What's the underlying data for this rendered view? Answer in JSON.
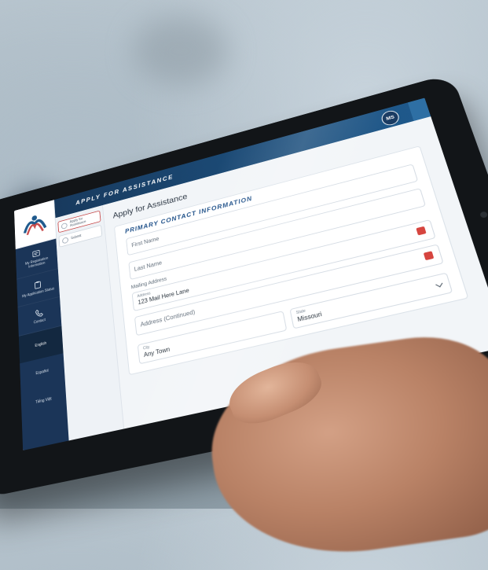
{
  "app": {
    "topbar_title": "APPLY FOR ASSISTANCE",
    "badge": "MS"
  },
  "left_nav": {
    "items": [
      {
        "label": "My Registration Information",
        "icon": "id-card-icon"
      },
      {
        "label": "My Application Status",
        "icon": "clipboard-icon"
      },
      {
        "label": "Contact",
        "icon": "phone-icon"
      }
    ],
    "languages": [
      "English",
      "Español",
      "Tiếng Việt"
    ]
  },
  "steps": [
    {
      "label": "Apply for Assistance",
      "active": true
    },
    {
      "label": "Submit",
      "active": false
    }
  ],
  "main": {
    "title": "Apply for Assistance",
    "section_title": "PRIMARY CONTACT INFORMATION",
    "fields": {
      "first_name": {
        "label": "First Name",
        "value": ""
      },
      "last_name": {
        "label": "Last Name",
        "value": ""
      },
      "mailing_address_label": "Mailing Address",
      "address": {
        "label": "Address",
        "value": "123 Mail Here Lane"
      },
      "address2": {
        "placeholder": "Address (Continued)"
      },
      "city": {
        "label": "City",
        "value": "Any Town"
      },
      "state": {
        "label": "State",
        "value": "Missouri"
      }
    }
  },
  "colors": {
    "topbar": "#1f5a8d",
    "nav": "#1b3558",
    "accent_red": "#d6453f",
    "section_blue": "#1d4f88"
  }
}
